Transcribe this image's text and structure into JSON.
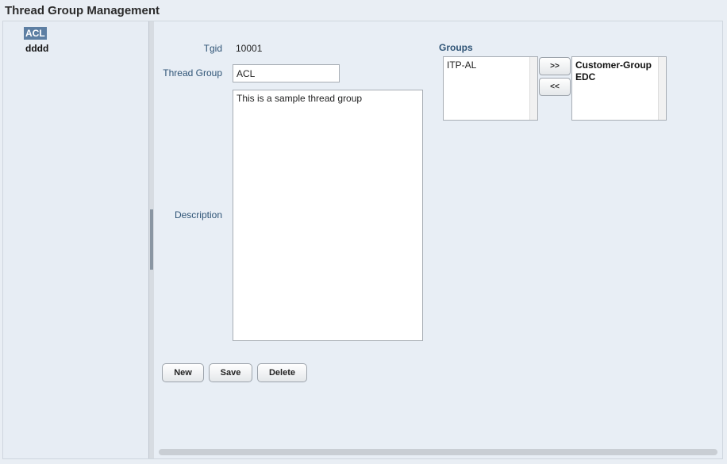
{
  "page": {
    "title": "Thread Group Management"
  },
  "tree": {
    "items": [
      {
        "label": "ACL",
        "selected": true
      },
      {
        "label": "dddd",
        "selected": false
      }
    ]
  },
  "form": {
    "tgid_label": "Tgid",
    "tgid_value": "10001",
    "thread_group_label": "Thread Group",
    "thread_group_value": "ACL",
    "description_label": "Description",
    "description_value": "This is a sample thread group"
  },
  "groups": {
    "title": "Groups",
    "available": [
      "ITP-AL"
    ],
    "assigned": [
      "Customer-Group",
      "EDC"
    ],
    "add_label": ">>",
    "remove_label": "<<"
  },
  "buttons": {
    "new": "New",
    "save": "Save",
    "delete": "Delete"
  }
}
